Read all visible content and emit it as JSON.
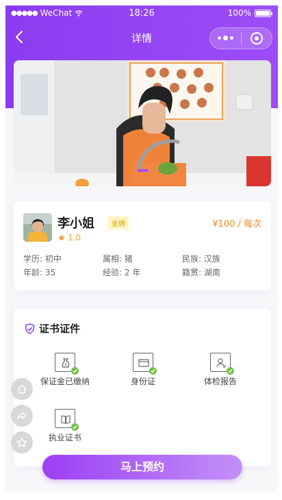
{
  "status_bar": {
    "signal": "●●●●●",
    "carrier": "WeChat",
    "time": "18:26",
    "battery": "100%"
  },
  "nav": {
    "title": "详情"
  },
  "profile": {
    "name": "李小姐",
    "badge": "金牌",
    "rating": "1.0",
    "price": "¥100 / 每次",
    "info": [
      [
        {
          "label": "学历:",
          "value": "初中"
        },
        {
          "label": "属相:",
          "value": "猪"
        },
        {
          "label": "民族:",
          "value": "汉族"
        }
      ],
      [
        {
          "label": "年龄:",
          "value": "35"
        },
        {
          "label": "经验:",
          "value": "2 年"
        },
        {
          "label": "籍贯:",
          "value": "湖南"
        }
      ]
    ]
  },
  "certificates": {
    "title": "证书证件",
    "items": [
      {
        "label": "保证金已缴纳",
        "icon": "money-bag-icon",
        "verified": true
      },
      {
        "label": "身份证",
        "icon": "id-card-icon",
        "verified": true
      },
      {
        "label": "体检报告",
        "icon": "health-report-icon",
        "verified": true
      },
      {
        "label": "执业证书",
        "icon": "book-icon",
        "verified": true
      }
    ]
  },
  "float_actions": [
    "home-icon",
    "share-icon",
    "star-icon"
  ],
  "book_button": {
    "label": "马上预约"
  },
  "colors": {
    "primary": "#8c3cf0",
    "price": "#f08a1e",
    "badge": "#d9a300",
    "check": "#7ac04a"
  }
}
